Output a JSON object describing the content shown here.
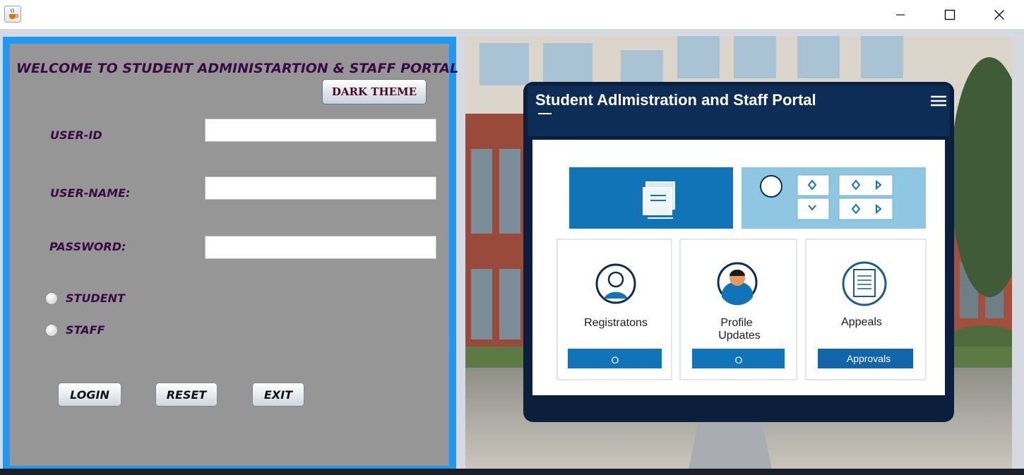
{
  "window": {
    "app_icon": "java-coffee-icon",
    "controls": [
      "minimize-icon",
      "maximize-icon",
      "close-icon"
    ]
  },
  "login": {
    "heading": "WELCOME TO STUDENT ADMINISTARTION & STAFF PORTAL",
    "theme_button": "DARK THEME",
    "fields": {
      "user_id_label": "USER-ID",
      "user_name_label": "USER-NAME:",
      "password_label": "PASSWORD:",
      "user_id_value": "",
      "user_name_value": "",
      "password_value": ""
    },
    "roles": {
      "student_label": "STUDENT",
      "staff_label": "STAFF",
      "selected": null
    },
    "buttons": {
      "login": "LOGIN",
      "reset": "RESET",
      "exit": "EXIT"
    }
  },
  "illustration": {
    "portal_title": "Student Adlmistration and Staff Portal",
    "menu_icon": "hamburger-menu-icon",
    "cards": [
      {
        "label": "Registratons",
        "button": "O",
        "icon": "user-avatar-icon"
      },
      {
        "label_line1": "Profile",
        "label_line2": "Updates",
        "button": "O",
        "icon": "profile-person-icon"
      },
      {
        "label": "Appeals",
        "button": "Approvals",
        "icon": "document-list-icon"
      }
    ]
  },
  "colors": {
    "panel_border": "#1e98f0",
    "panel_background": "#969696",
    "label_text": "#3a0a45",
    "portal_navy": "#0d2b55",
    "portal_blue": "#1173b8"
  }
}
